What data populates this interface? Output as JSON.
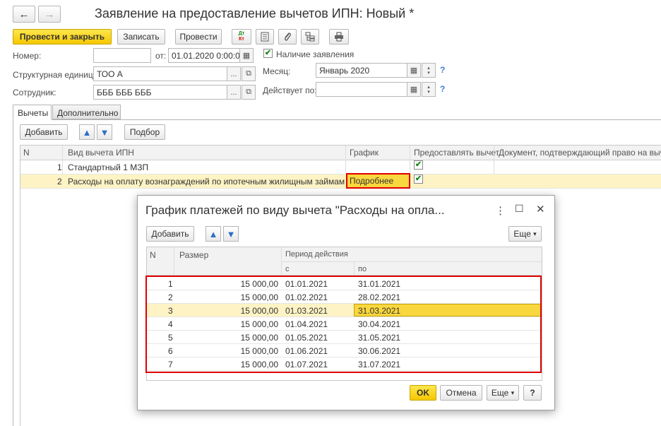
{
  "window": {
    "title": "Заявление на предоставление вычетов ИПН: Новый *",
    "back_icon": "←",
    "forward_icon": "→"
  },
  "toolbar": {
    "post_close": "Провести и закрыть",
    "write": "Записать",
    "post": "Провести",
    "dtkt_top": "Дт",
    "dtkt_bottom": "Кт"
  },
  "form": {
    "number_label": "Номер:",
    "number_value": "",
    "from_label": "от:",
    "date_value": "01.01.2020  0:00:00",
    "statement_label": "Наличие заявления",
    "unit_label": "Структурная единица:",
    "unit_value": "ТОО А",
    "month_label": "Месяц:",
    "month_value": "Январь 2020",
    "employee_label": "Сотрудник:",
    "employee_value": "БББ БББ БББ",
    "valid_label": "Действует по:",
    "valid_value": "",
    "help": "?",
    "ellipsis": "...",
    "open_glyph": "⧉",
    "cal_glyph": "▦"
  },
  "tabs": [
    "Вычеты",
    "Дополнительно"
  ],
  "tab_toolbar": {
    "add": "Добавить",
    "pick": "Подбор",
    "up": "🡅",
    "down": "🡇"
  },
  "main_table": {
    "headers": [
      "N",
      "Вид вычета ИПН",
      "График",
      "Предоставлять вычет",
      "Документ, подтверждающий право на вычет"
    ],
    "rows": [
      {
        "n": "1",
        "type": "Стандартный 1 МЗП",
        "schedule": "",
        "provide": "✔"
      },
      {
        "n": "2",
        "type": "Расходы на оплату вознаграждений по ипотечным жилищным займам",
        "schedule": "Подробнее",
        "provide": "✔"
      }
    ]
  },
  "dialog": {
    "title": "График платежей по виду вычета \"Расходы на опла...",
    "menu_icon": "⋮",
    "max_icon": "☐",
    "close_icon": "✕",
    "add": "Добавить",
    "more": "Еще",
    "more_arrow": "▾",
    "headers": {
      "n": "N",
      "size": "Размер",
      "period": "Период действия",
      "from": "с",
      "to": "по"
    },
    "rows": [
      {
        "n": "1",
        "size": "15 000,00",
        "from": "01.01.2021",
        "to": "31.01.2021"
      },
      {
        "n": "2",
        "size": "15 000,00",
        "from": "01.02.2021",
        "to": "28.02.2021"
      },
      {
        "n": "3",
        "size": "15 000,00",
        "from": "01.03.2021",
        "to": "31.03.2021"
      },
      {
        "n": "4",
        "size": "15 000,00",
        "from": "01.04.2021",
        "to": "30.04.2021"
      },
      {
        "n": "5",
        "size": "15 000,00",
        "from": "01.05.2021",
        "to": "31.05.2021"
      },
      {
        "n": "6",
        "size": "15 000,00",
        "from": "01.06.2021",
        "to": "30.06.2021"
      },
      {
        "n": "7",
        "size": "15 000,00",
        "from": "01.07.2021",
        "to": "31.07.2021"
      }
    ],
    "ok": "OK",
    "cancel": "Отмена",
    "help": "?"
  },
  "colors": {
    "accent_yellow": "#f4c700",
    "highlight_row": "#fdf3c4",
    "red_frame": "#e00000",
    "blue_arrow": "#2c6fc5"
  }
}
